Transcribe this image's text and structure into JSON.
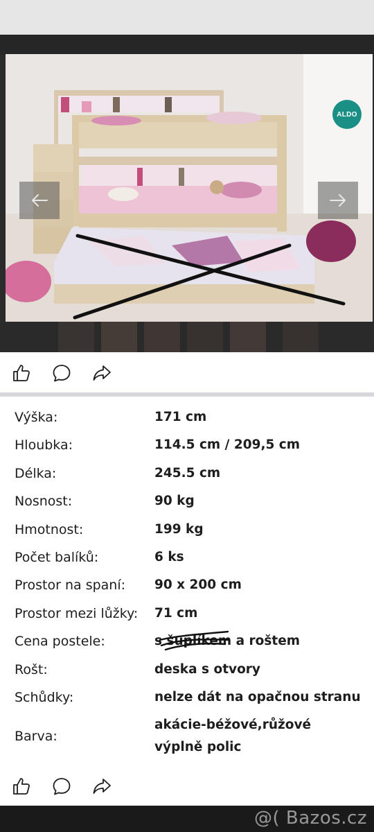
{
  "brand": {
    "logo_text": "ALDO",
    "watermark": "@( Bazos.cz"
  },
  "icons": {
    "like": "thumbs-up-icon",
    "comment": "speech-bubble-icon",
    "share": "share-arrow-icon",
    "prev": "arrow-left-icon",
    "next": "arrow-right-icon"
  },
  "specs": [
    {
      "label": "Výška:",
      "value": "171 cm"
    },
    {
      "label": "Hloubka:",
      "value": "114.5 cm / 209,5 cm"
    },
    {
      "label": "Délka:",
      "value": "245.5 cm"
    },
    {
      "label": "Nosnost:",
      "value": "90 kg"
    },
    {
      "label": "Hmotnost:",
      "value": "199 kg"
    },
    {
      "label": "Počet balíků:",
      "value": "6 ks"
    },
    {
      "label": "Prostor na spaní:",
      "value": "90 x 200 cm"
    },
    {
      "label": "Prostor mezi lůžky:",
      "value": "71 cm"
    },
    {
      "label": "Cena postele:",
      "value": "s šuplíkem a roštem"
    },
    {
      "label": "Rošt:",
      "value": "deska s otvory"
    },
    {
      "label": "Schůdky:",
      "value": "nelze dát na opačnou stranu"
    },
    {
      "label": "Barva:",
      "value": "akácie-béžové,růžové výplně polic"
    }
  ]
}
